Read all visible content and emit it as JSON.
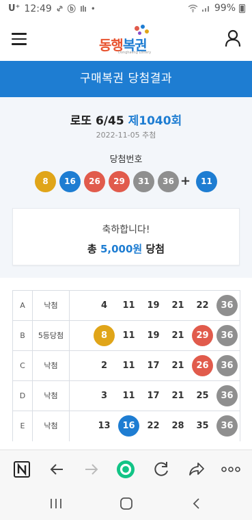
{
  "status_bar": {
    "carrier": "U⁺",
    "time": "12:49",
    "left_icons": [
      "link-icon",
      "b-icon",
      "notification-icon",
      "dot-icon"
    ],
    "battery": "99%"
  },
  "header": {
    "logo_text_1": "동행",
    "logo_text_2": "복권",
    "logo_sub": "Donghaeng Lottery"
  },
  "title_bar": {
    "title": "구매복권 당첨결과"
  },
  "draw": {
    "game_label": "로또 6/45",
    "round": "제1040회",
    "date": "2022-11-05 추첨",
    "winning_label": "당첨번호",
    "winning_numbers": [
      {
        "num": "8",
        "color": "#e0a519"
      },
      {
        "num": "16",
        "color": "#1e7dd2"
      },
      {
        "num": "26",
        "color": "#e15b4c"
      },
      {
        "num": "29",
        "color": "#e15b4c"
      },
      {
        "num": "31",
        "color": "#8f8f8f"
      },
      {
        "num": "36",
        "color": "#8f8f8f"
      }
    ],
    "plus": "+",
    "bonus": {
      "num": "11",
      "color": "#1e7dd2"
    }
  },
  "result": {
    "message": "축하합니다!",
    "prize_prefix": "총",
    "prize_amount": "5,000원",
    "prize_suffix": "당첨"
  },
  "tickets": [
    {
      "line": "A",
      "result": "낙첨",
      "numbers": [
        {
          "n": "4",
          "hit": false
        },
        {
          "n": "11",
          "hit": false
        },
        {
          "n": "19",
          "hit": false
        },
        {
          "n": "21",
          "hit": false
        },
        {
          "n": "22",
          "hit": false
        },
        {
          "n": "36",
          "hit": true,
          "color": "#8f8f8f"
        }
      ]
    },
    {
      "line": "B",
      "result": "5등당첨",
      "numbers": [
        {
          "n": "8",
          "hit": true,
          "color": "#e0a519"
        },
        {
          "n": "11",
          "hit": false
        },
        {
          "n": "19",
          "hit": false
        },
        {
          "n": "21",
          "hit": false
        },
        {
          "n": "29",
          "hit": true,
          "color": "#e15b4c"
        },
        {
          "n": "36",
          "hit": true,
          "color": "#8f8f8f"
        }
      ]
    },
    {
      "line": "C",
      "result": "낙첨",
      "numbers": [
        {
          "n": "2",
          "hit": false
        },
        {
          "n": "11",
          "hit": false
        },
        {
          "n": "17",
          "hit": false
        },
        {
          "n": "21",
          "hit": false
        },
        {
          "n": "26",
          "hit": true,
          "color": "#e15b4c"
        },
        {
          "n": "36",
          "hit": true,
          "color": "#8f8f8f"
        }
      ]
    },
    {
      "line": "D",
      "result": "낙첨",
      "numbers": [
        {
          "n": "3",
          "hit": false
        },
        {
          "n": "11",
          "hit": false
        },
        {
          "n": "17",
          "hit": false
        },
        {
          "n": "21",
          "hit": false
        },
        {
          "n": "25",
          "hit": false
        },
        {
          "n": "36",
          "hit": true,
          "color": "#8f8f8f"
        }
      ]
    },
    {
      "line": "E",
      "result": "낙첨",
      "numbers": [
        {
          "n": "13",
          "hit": false
        },
        {
          "n": "16",
          "hit": true,
          "color": "#1e7dd2"
        },
        {
          "n": "22",
          "hit": false
        },
        {
          "n": "28",
          "hit": false
        },
        {
          "n": "35",
          "hit": false
        },
        {
          "n": "36",
          "hit": true,
          "color": "#8f8f8f"
        }
      ]
    }
  ],
  "browser_bar": {
    "buttons": [
      "naver-icon",
      "back-arrow-icon",
      "forward-arrow-icon",
      "home-circle-icon",
      "refresh-icon",
      "share-icon",
      "more-icon"
    ]
  },
  "nav_bar": {
    "buttons": [
      "recent-apps-icon",
      "home-icon",
      "back-icon"
    ]
  },
  "colors": {
    "primary_blue": "#1e7dd2",
    "ball_yellow": "#e0a519",
    "ball_blue": "#1e7dd2",
    "ball_red": "#e15b4c",
    "ball_gray": "#8f8f8f",
    "home_green": "#12c486"
  }
}
